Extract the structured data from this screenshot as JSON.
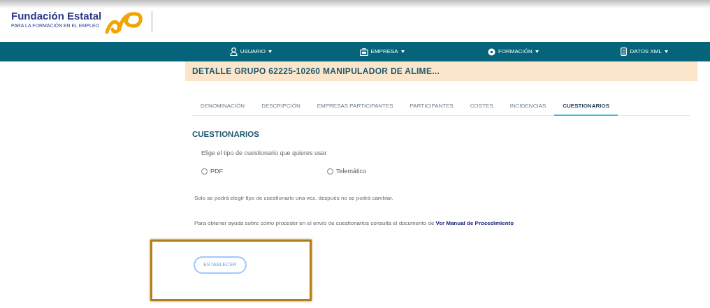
{
  "logo": {
    "title": "Fundación Estatal",
    "subtitle": "PARA LA FORMACIÓN EN EL EMPLEO"
  },
  "nav": [
    {
      "label": "USUARIO"
    },
    {
      "label": "EMPRESA"
    },
    {
      "label": "FORMACIÓN"
    },
    {
      "label": "DATOS XML"
    }
  ],
  "banner": "DETALLE GRUPO 62225-10260 MANIPULADOR DE ALIME...",
  "tabs": [
    {
      "label": "DENOMINACIÓN",
      "selected": false
    },
    {
      "label": "DESCRIPCIÓN",
      "selected": false
    },
    {
      "label": "EMPRESAS PARTICIPANTES",
      "selected": false
    },
    {
      "label": "PARTICIPANTES",
      "selected": false
    },
    {
      "label": "COSTES",
      "selected": false
    },
    {
      "label": "INCIDENCIAS",
      "selected": false
    },
    {
      "label": "CUESTIONARIOS",
      "selected": true
    }
  ],
  "section_title": "CUESTIONARIOS",
  "prompt": "Elige el tipo de cuestionario que quieres usar",
  "options": [
    {
      "label": "PDF",
      "selected": false
    },
    {
      "label": "Telemático",
      "selected": false
    }
  ],
  "note": "Solo se podrá elegir tipo de cuestionario una vez, después no se podrá cambiar.",
  "help": {
    "text": "Para obtener ayuda sobre cómo proceder en el envío de cuestionarios consulta el documento de",
    "link": "Ver Manual de Procedimiento"
  },
  "button": "ESTABLECER"
}
